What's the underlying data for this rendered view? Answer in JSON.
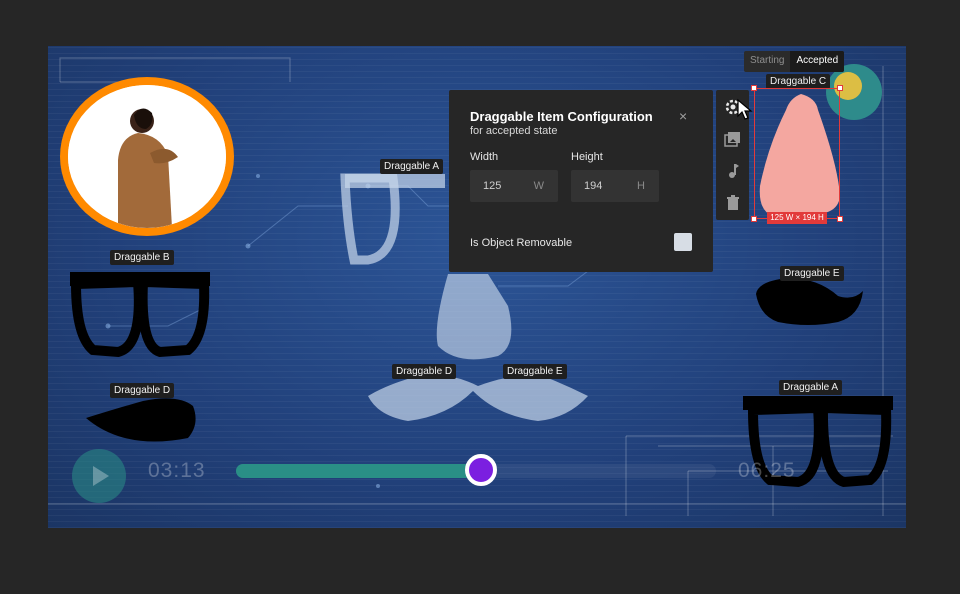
{
  "state_toggle": {
    "options": [
      "Starting",
      "Accepted"
    ],
    "active": "Accepted"
  },
  "draggables": {
    "a_center": "Draggable A",
    "b_left": "Draggable B",
    "c_selected": "Draggable C",
    "d_bottom_left": "Draggable D",
    "d_center": "Draggable D",
    "e_center": "Draggable E",
    "e_right": "Draggable E",
    "a_right": "Draggable A"
  },
  "config_panel": {
    "title": "Draggable Item Configuration",
    "subtitle": "for accepted state",
    "close_glyph": "×",
    "width_label": "Width",
    "width_value": "125",
    "width_unit": "W",
    "height_label": "Height",
    "height_value": "194",
    "height_unit": "H",
    "removable_label": "Is Object Removable",
    "removable_checked": false
  },
  "toolbar": {
    "icons": [
      "settings-icon",
      "image-icon",
      "music-icon",
      "trash-icon"
    ]
  },
  "selection": {
    "dimension_label": "125  W × 194  H"
  },
  "player": {
    "current_time": "03:13",
    "total_time": "06:25",
    "progress": 0.51
  },
  "colors": {
    "stage": "#21407a",
    "avatar_ring": "#ff8a00",
    "selection": "#e23a3a",
    "progress_fill": "#2a8f86",
    "thumb": "#7b1fe0"
  }
}
